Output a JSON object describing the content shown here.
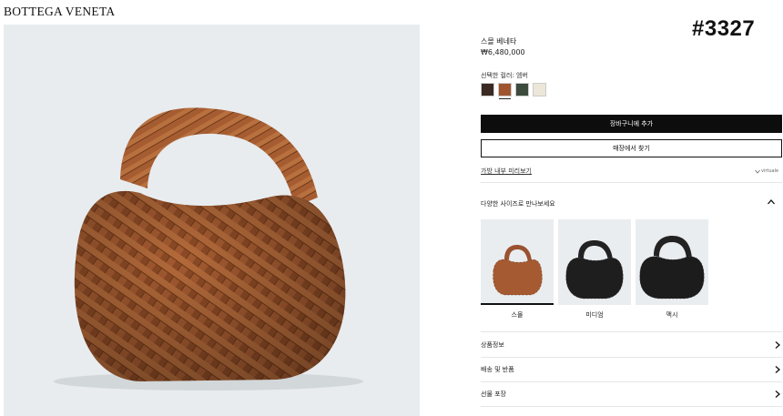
{
  "brand": "BOTTEGA VENETA",
  "code": "#3327",
  "product": {
    "name": "스몰 베네타",
    "price": "₩6,480,000",
    "color_label": "선택한 컬러: 엠버"
  },
  "swatches": [
    {
      "color": "#3a2a22",
      "name": "dark-brown"
    },
    {
      "color": "#a0552e",
      "name": "amber",
      "selected": true
    },
    {
      "color": "#3d4a3e",
      "name": "dark-green"
    },
    {
      "color": "#ece6d8",
      "name": "cream"
    }
  ],
  "actions": {
    "add_to_cart": "장바구니에 추가",
    "find_in_store": "매장에서 찾기"
  },
  "preview_link": "가방 내부 미리보기",
  "virtuale_label": "virtuale",
  "sizes": {
    "heading": "다양한 사이즈로 만나보세요",
    "items": [
      {
        "label": "스몰",
        "color": "#a0552e",
        "selected": true
      },
      {
        "label": "미디엄",
        "color": "#1e1e1e"
      },
      {
        "label": "맥시",
        "color": "#1c1c1c"
      }
    ]
  },
  "accordion": [
    {
      "label": "상품정보"
    },
    {
      "label": "배송 및 반품"
    },
    {
      "label": "선물 포장"
    }
  ],
  "colors": {
    "hero_bg": "#e8ecef",
    "bag": "#a0552e",
    "button_dark": "#0d0d0d"
  }
}
